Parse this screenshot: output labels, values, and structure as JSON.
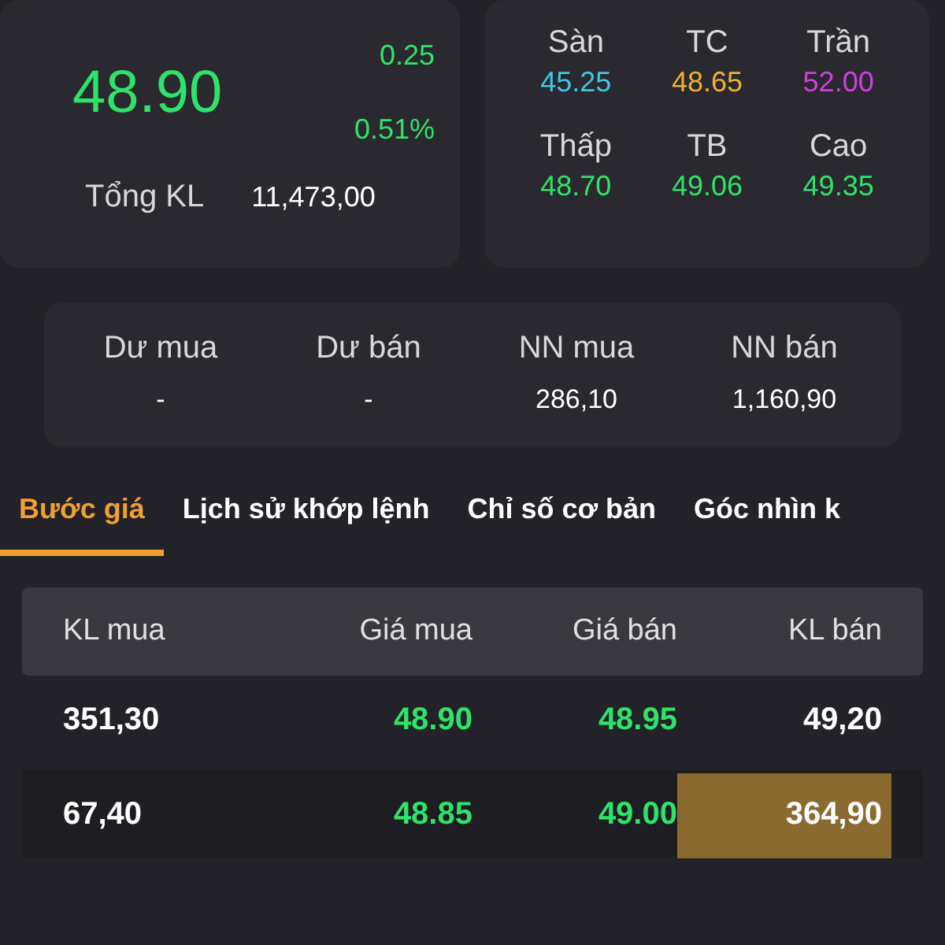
{
  "quote": {
    "price": "48.90",
    "change": "0.25",
    "change_pct": "0.51%",
    "volume_label": "Tổng KL",
    "volume": "11,473,00"
  },
  "ref_prices": [
    {
      "label": "Sàn",
      "value": "45.25",
      "color": "#3fc8e0"
    },
    {
      "label": "TC",
      "value": "48.65",
      "color": "#f0b030"
    },
    {
      "label": "Trần",
      "value": "52.00",
      "color": "#d040e0"
    },
    {
      "label": "Thấp",
      "value": "48.70",
      "color": "#2ee26a"
    },
    {
      "label": "TB",
      "value": "49.06",
      "color": "#2ee26a"
    },
    {
      "label": "Cao",
      "value": "49.35",
      "color": "#2ee26a"
    }
  ],
  "surplus": [
    {
      "label": "Dư mua",
      "value": "-"
    },
    {
      "label": "Dư bán",
      "value": "-"
    },
    {
      "label": "NN mua",
      "value": "286,10"
    },
    {
      "label": "NN bán",
      "value": "1,160,90"
    }
  ],
  "tabs": [
    {
      "label": "Bước giá",
      "selected": true
    },
    {
      "label": "Lịch sử khớp lệnh",
      "selected": false
    },
    {
      "label": "Chỉ số cơ bản",
      "selected": false
    },
    {
      "label": "Góc nhìn k",
      "selected": false
    }
  ],
  "table": {
    "columns": [
      "KL mua",
      "Giá mua",
      "Giá bán",
      "KL bán"
    ],
    "rows": [
      {
        "buy_volume": "351,30",
        "buy_price": "48.90",
        "sell_price": "48.95",
        "sell_volume": {
          "text": "49,20"
        }
      },
      {
        "buy_volume": "67,40",
        "buy_price": "48.85",
        "sell_price": "49.00",
        "sell_volume": {
          "text": "364,90",
          "level": 0.85
        }
      }
    ]
  }
}
